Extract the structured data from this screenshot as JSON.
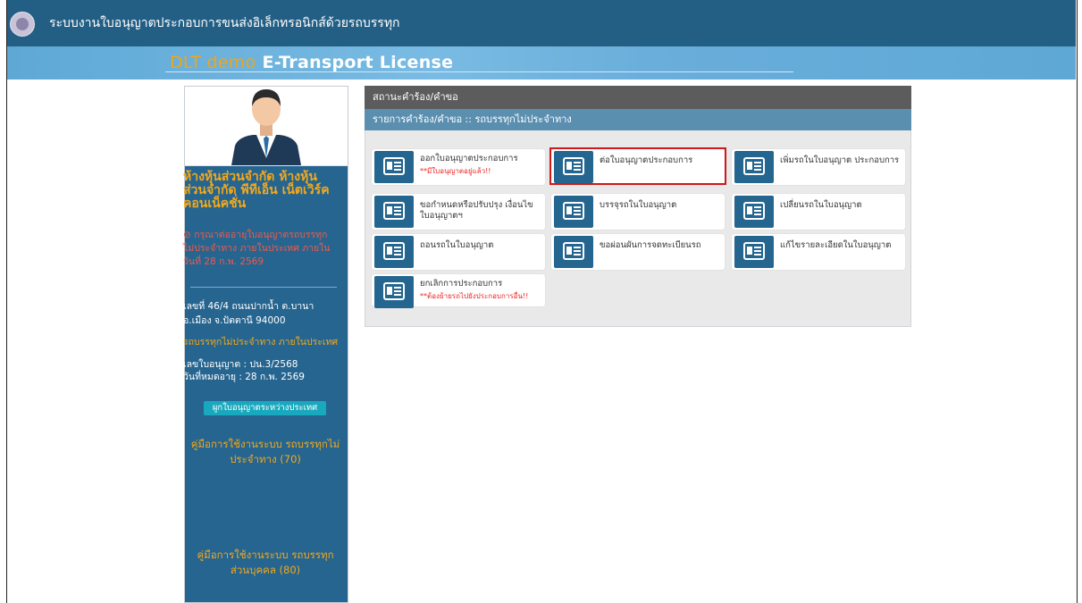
{
  "header": {
    "system_title": "ระบบงานใบอนุญาตประกอบการขนส่งอิเล็กทรอนิกส์ด้วยรถบรรทุก",
    "brand_prefix": "DLT demo",
    "brand_suffix": "E-Transport License"
  },
  "sidebar": {
    "company_name": "ห้างหุ้นส่วนจำกัด ห้างหุ้นส่วนจำกัด พีทีเอ็น เน็ตเวิร์ค คอนเน็คชั่น",
    "warning": "⊘ กรุณาต่ออายุใบอนุญาตรถบรรทุกไม่ประจำทาง ภายในประเทศ ภายในวันที่ 28 ก.พ. 2569",
    "address": "เลขที่ 46/4 ถนนปากน้ำ ต.บานา อ.เมือง จ.ปัตตานี 94000",
    "license_type": "รถบรรทุกไม่ประจำทาง ภายในประเทศ",
    "license_number": "เลขใบอนุญาต : ปน.3/2568",
    "expiry": "วันที่หมดอายุ : 28 ก.พ. 2569",
    "bind_button": "ผูกใบอนุญาตระหว่างประเทศ",
    "manual_1": "คู่มือการใช้งานระบบ รถบรรทุกไม่ประจำทาง (70)",
    "manual_2": "คู่มือการใช้งานระบบ รถบรรทุกส่วนบุคคล (80)"
  },
  "panel": {
    "header": "สถานะคำร้อง/คำขอ",
    "subheader": "รายการคำร้อง/คำขอ :: รถบรรทุกไม่ประจำทาง",
    "cards": [
      {
        "label": "ออกใบอนุญาตประกอบการ",
        "note": "**มีใบอนุญาตอยู่แล้ว!!"
      },
      {
        "label": "ต่อใบอนุญาตประกอบการ",
        "note": ""
      },
      {
        "label": "เพิ่มรถในใบอนุญาต ประกอบการ",
        "note": ""
      },
      {
        "label": "ขอกำหนดหรือปรับปรุง เงื่อนไขใบอนุญาตฯ",
        "note": ""
      },
      {
        "label": "บรรจุรถในใบอนุญาต",
        "note": ""
      },
      {
        "label": "เปลี่ยนรถในใบอนุญาต",
        "note": ""
      },
      {
        "label": "ถอนรถในใบอนุญาต",
        "note": ""
      },
      {
        "label": "ขอผ่อนผันการจดทะเบียนรถ",
        "note": ""
      },
      {
        "label": "แก้ไขรายละเอียดในใบอนุญาต",
        "note": ""
      },
      {
        "label": "ยกเลิกการประกอบการ",
        "note": "**ต้องย้ายรถไปยังประกอบการอื่น!!"
      }
    ]
  },
  "colors": {
    "topbar": "#235f85",
    "banner": "#5ea8d6",
    "accent_orange": "#f5a818",
    "sidebar": "#266590",
    "warning_red": "#ef5a4a",
    "highlight_red": "#d01818"
  },
  "icons": {
    "logo": "department-seal-icon",
    "card_icon": "document-form-icon"
  }
}
